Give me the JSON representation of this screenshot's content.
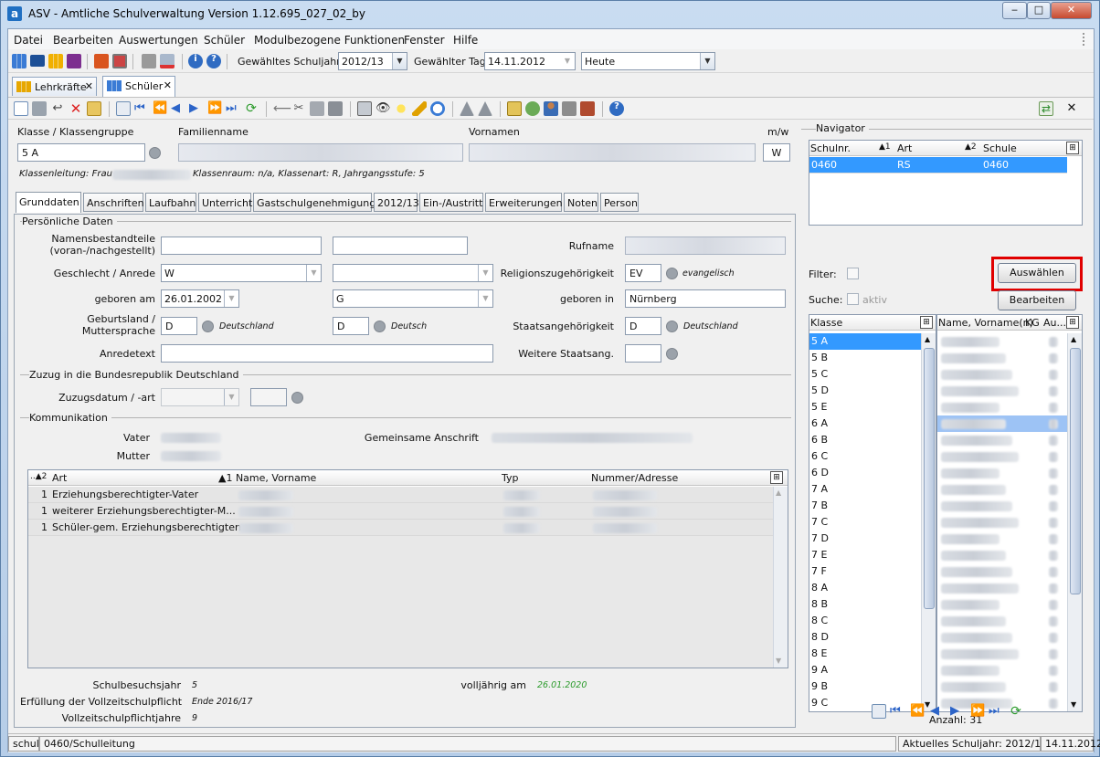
{
  "window": {
    "title": "ASV - Amtliche Schulverwaltung Version 1.12.695_027_02_by",
    "app_icon": "a",
    "controls": [
      "minimize",
      "maximize",
      "close"
    ]
  },
  "menubar": [
    "Datei",
    "Bearbeiten",
    "Auswertungen",
    "Schüler",
    "Modulbezogene Funktionen",
    "Fenster",
    "Hilfe"
  ],
  "toolbar": {
    "schuljahr_label": "Gewähltes Schuljahr",
    "schuljahr_value": "2012/13",
    "tag_label": "Gewählter Tag",
    "tag_value": "14.11.2012",
    "heute_value": "Heute"
  },
  "doc_tabs": [
    {
      "label": "Lehrkräfte",
      "close": "✕"
    },
    {
      "label": "Schüler",
      "close": "✕"
    }
  ],
  "header": {
    "klasse_label": "Klasse / Klassengruppe",
    "klasse_value": "5 A",
    "familienname_label": "Familienname",
    "vornamen_label": "Vornamen",
    "mw_label": "m/w",
    "mw_value": "W",
    "info_prefix": "Klassenleitung: Frau",
    "info_suffix": "Klassenraum: n/a, Klassenart: R, Jahrgangsstufe: 5"
  },
  "form_tabs": [
    "Grunddaten",
    "Anschriften",
    "Laufbahn",
    "Unterricht",
    "Gastschulgenehmigung",
    "2012/13",
    "Ein-/Austritt",
    "Erweiterungen",
    "Noten",
    "Person"
  ],
  "persoenlich": {
    "section": "Persönliche Daten",
    "namensteile_label_1": "Namensbestandteile",
    "namensteile_label_2": "(voran-/nachgestellt)",
    "rufname_label": "Rufname",
    "geschlecht_label": "Geschlecht / Anrede",
    "geschlecht_value": "W",
    "religion_label": "Religionszugehörigkeit",
    "religion_value": "EV",
    "religion_text": "evangelisch",
    "geboren_am_label": "geboren am",
    "geboren_am_value": "26.01.2002",
    "g_value": "G",
    "geboren_in_label": "geboren in",
    "geboren_in_value": "Nürnberg",
    "geburtsland_label_1": "Geburtsland /",
    "geburtsland_label_2": "Muttersprache",
    "geburtsland_value": "D",
    "geburtsland_text": "Deutschland",
    "muttersprache_value": "D",
    "muttersprache_text": "Deutsch",
    "staat_label": "Staatsangehörigkeit",
    "staat_value": "D",
    "staat_text": "Deutschland",
    "anrede_label": "Anredetext",
    "weitere_label": "Weitere Staatsang."
  },
  "zuzug": {
    "section": "Zuzug in die Bundesrepublik Deutschland",
    "datum_label": "Zuzugsdatum / -art"
  },
  "kommunikation": {
    "section": "Kommunikation",
    "vater_label": "Vater",
    "mutter_label": "Mutter",
    "anschrift_label": "Gemeinsame Anschrift",
    "grid_headers": [
      "..▲2",
      "Art",
      "▲1 Name, Vorname",
      "Typ",
      "Nummer/Adresse"
    ],
    "rows": [
      {
        "n": "1",
        "art": "Erziehungsberechtigter-Vater"
      },
      {
        "n": "1",
        "art": "weiterer Erziehungsberechtigter-M..."
      },
      {
        "n": "1",
        "art": "Schüler-gem. Erziehungsberechtigten"
      }
    ]
  },
  "footer": {
    "schulbesuchsjahr_label": "Schulbesuchsjahr",
    "schulbesuchsjahr_value": "5",
    "volljaehrig_label": "volljährig am",
    "volljaehrig_value": "26.01.2020",
    "erfuellung_label": "Erfüllung der Vollzeitschulpflicht",
    "erfuellung_value": "Ende 2016/17",
    "vollzeit_label": "Vollzeitschulpflichtjahre",
    "vollzeit_value": "9"
  },
  "navigator": {
    "title": "Navigator",
    "headers": [
      "Schulnr.",
      "▲1",
      "Art",
      "▲2",
      "Schule"
    ],
    "row": {
      "schulnr": "0460",
      "art": "RS",
      "schule": "0460"
    },
    "filter_label": "Filter:",
    "suche_label": "Suche:",
    "aktiv_label": "aktiv",
    "auswaehlen": "Auswählen",
    "bearbeiten": "Bearbeiten",
    "klasse_header": "Klasse",
    "name_header": "Name, Vorname(n)",
    "kg_header": "KG",
    "au_header": "Au...",
    "klassen": [
      "5 A",
      "5 B",
      "5 C",
      "5 D",
      "5 E",
      "6 A",
      "6 B",
      "6 C",
      "6 D",
      "7 A",
      "7 B",
      "7 C",
      "7 D",
      "7 E",
      "7 F",
      "8 A",
      "8 B",
      "8 C",
      "8 D",
      "8 E",
      "9 A",
      "9 B",
      "9 C"
    ],
    "anzahl": "Anzahl: 31"
  },
  "status": {
    "left": "schul",
    "path": "0460/Schulleitung",
    "year": "Aktuelles Schuljahr: 2012/13",
    "date": "14.11.2012"
  },
  "colors": {
    "selection": "#3399ff",
    "highlight_border": "#e00000",
    "date_green": "#2a9a2a"
  }
}
